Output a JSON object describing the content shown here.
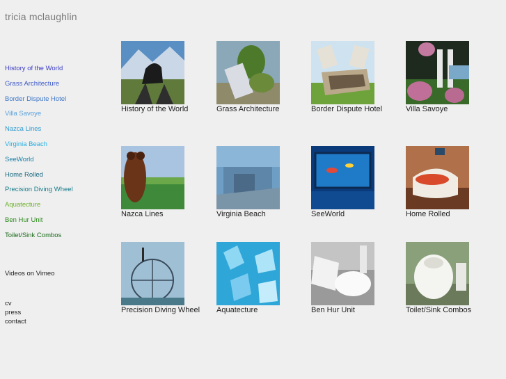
{
  "site": {
    "title": "tricia mclaughlin"
  },
  "nav": {
    "items": [
      {
        "label": "History of the World",
        "color": "#3b3bc4"
      },
      {
        "label": "Grass Architecture",
        "color": "#3b57c8"
      },
      {
        "label": "Border Dispute Hotel",
        "color": "#3f78c8"
      },
      {
        "label": "Villa Savoye",
        "color": "#5aa0dc"
      },
      {
        "label": "Nazca Lines",
        "color": "#2a9ad0"
      },
      {
        "label": "Virginia Beach",
        "color": "#22aee0"
      },
      {
        "label": "SeeWorld",
        "color": "#1a7fa8"
      },
      {
        "label": "Home Rolled",
        "color": "#1a6a80"
      },
      {
        "label": "Precision Diving Wheel",
        "color": "#1a7d8a"
      },
      {
        "label": "Aquatecture",
        "color": "#6cb02a"
      },
      {
        "label": "Ben Hur Unit",
        "color": "#2a8a1a"
      },
      {
        "label": "Toilet/Sink Combos",
        "color": "#1a6a1a"
      }
    ],
    "videos": "Videos on Vimeo",
    "cv": "cv",
    "press": "press",
    "contact": "contact"
  },
  "gallery": {
    "items": [
      {
        "caption": "History of the World",
        "icon": "history-of-the-world-thumbnail"
      },
      {
        "caption": "Grass Architecture",
        "icon": "grass-architecture-thumbnail"
      },
      {
        "caption": "Border Dispute Hotel",
        "icon": "border-dispute-hotel-thumbnail"
      },
      {
        "caption": "Villa Savoye",
        "icon": "villa-savoye-thumbnail"
      },
      {
        "caption": "Nazca Lines",
        "icon": "nazca-lines-thumbnail"
      },
      {
        "caption": "Virginia Beach",
        "icon": "virginia-beach-thumbnail"
      },
      {
        "caption": "SeeWorld",
        "icon": "seeworld-thumbnail"
      },
      {
        "caption": "Home Rolled",
        "icon": "home-rolled-thumbnail"
      },
      {
        "caption": "Precision Diving Wheel",
        "icon": "precision-diving-wheel-thumbnail"
      },
      {
        "caption": "Aquatecture",
        "icon": "aquatecture-thumbnail"
      },
      {
        "caption": "Ben Hur Unit",
        "icon": "ben-hur-unit-thumbnail"
      },
      {
        "caption": "Toilet/Sink Combos",
        "icon": "toilet-sink-combos-thumbnail"
      }
    ]
  }
}
